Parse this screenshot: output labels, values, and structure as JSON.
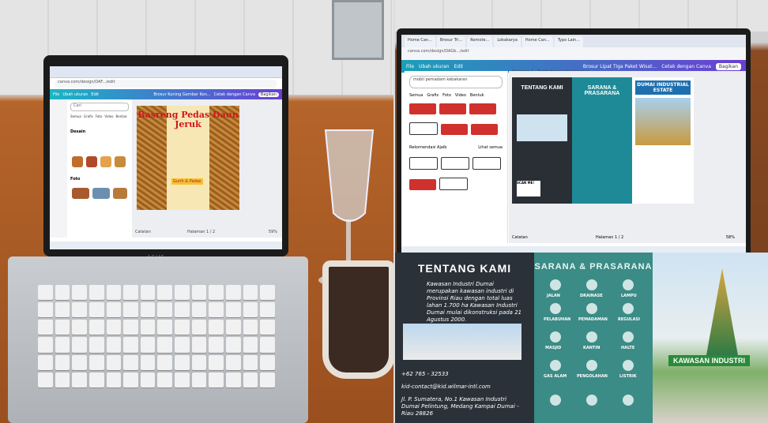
{
  "left_photo": {
    "device_brand": "ASUS",
    "screen": {
      "browser_url": "canva.com/design/DAF.../edit",
      "canva_toolbar": {
        "file": "File",
        "resize": "Ubah ukuran",
        "edit": "Edit",
        "doc_title": "Brosur Kuning Gambar Kon...",
        "share_label": "Bagikan",
        "print_label": "Cetak dengan Canva"
      },
      "search_placeholder": "Cari",
      "filter_tabs": [
        "Semua",
        "Grafis",
        "Foto",
        "Video",
        "Bentuk"
      ],
      "sections": [
        "Desain",
        "Foto"
      ],
      "design_title": "Basreng Pedas Daun Jeruk",
      "design_badge": "Gurih & Pedas",
      "status_left": "Catatan",
      "status_right": "Halaman 1 / 2",
      "zoom": "59%"
    }
  },
  "right_photo": {
    "screen": {
      "browser_url": "canva.com/design/DAGb.../edit",
      "tabs": [
        "Home Can...",
        "Brosur Tri...",
        "Remote...",
        "Lokakarya",
        "Home Can...",
        "Typo Lain..."
      ],
      "canva_toolbar": {
        "file": "File",
        "resize": "Ubah ukuran",
        "edit": "Edit",
        "doc_title": "Brosur Lipat Tiga Paket Wisat...",
        "print_label": "Cetak dengan Canva",
        "share_label": "Bagikan"
      },
      "page_label": "Halaman 1 - Tambahkan judul halaman",
      "search_value": "mobil pemadam kebakaran",
      "filter_tabs": [
        "Semua",
        "Grafis",
        "Foto",
        "Video",
        "Bentuk"
      ],
      "section_label": "Rekomendasi Ajaib",
      "section_action": "Lihat semua",
      "brochure": {
        "panel1_title": "TENTANG KAMI",
        "panel2_title": "SARANA & PRASARANA",
        "panel3_title": "DUMAI INDUSTRIAL ESTATE",
        "scan_label": "SCAN ME!"
      },
      "status_left": "Catatan",
      "status_right": "Halaman 1 / 2",
      "zoom": "58%"
    },
    "printed_brochure": {
      "panel1_title": "TENTANG KAMI",
      "panel1_text": "Kawasan Industri Dumai merupakan kawasan industri di Provinsi Riau dengan total luas lahan 1.700 ha Kawasan Industri Dumai mulai dikonstruksi pada 21 Agustus 2000.",
      "phone": "+62 765 - 32533",
      "email": "kid-contact@kid.wilmar-intl.com",
      "address": "Jl. P. Sumatera, No.1 Kawasan Industri Dumai Pelintung, Medang Kampai Dumai - Riau 28826",
      "panel2_title": "SARANA & PRASARANA",
      "facilities": [
        "JALAN",
        "DRAINASE",
        "LAMPU",
        "PELABUHAN",
        "PEMADAMAN",
        "REGULASI",
        "MASJID",
        "KANTIN",
        "HALTE",
        "GAS ALAM",
        "PENGOLAHAN",
        "LISTRIK"
      ],
      "panel3_sign": "KAWASAN INDUSTRI"
    }
  }
}
